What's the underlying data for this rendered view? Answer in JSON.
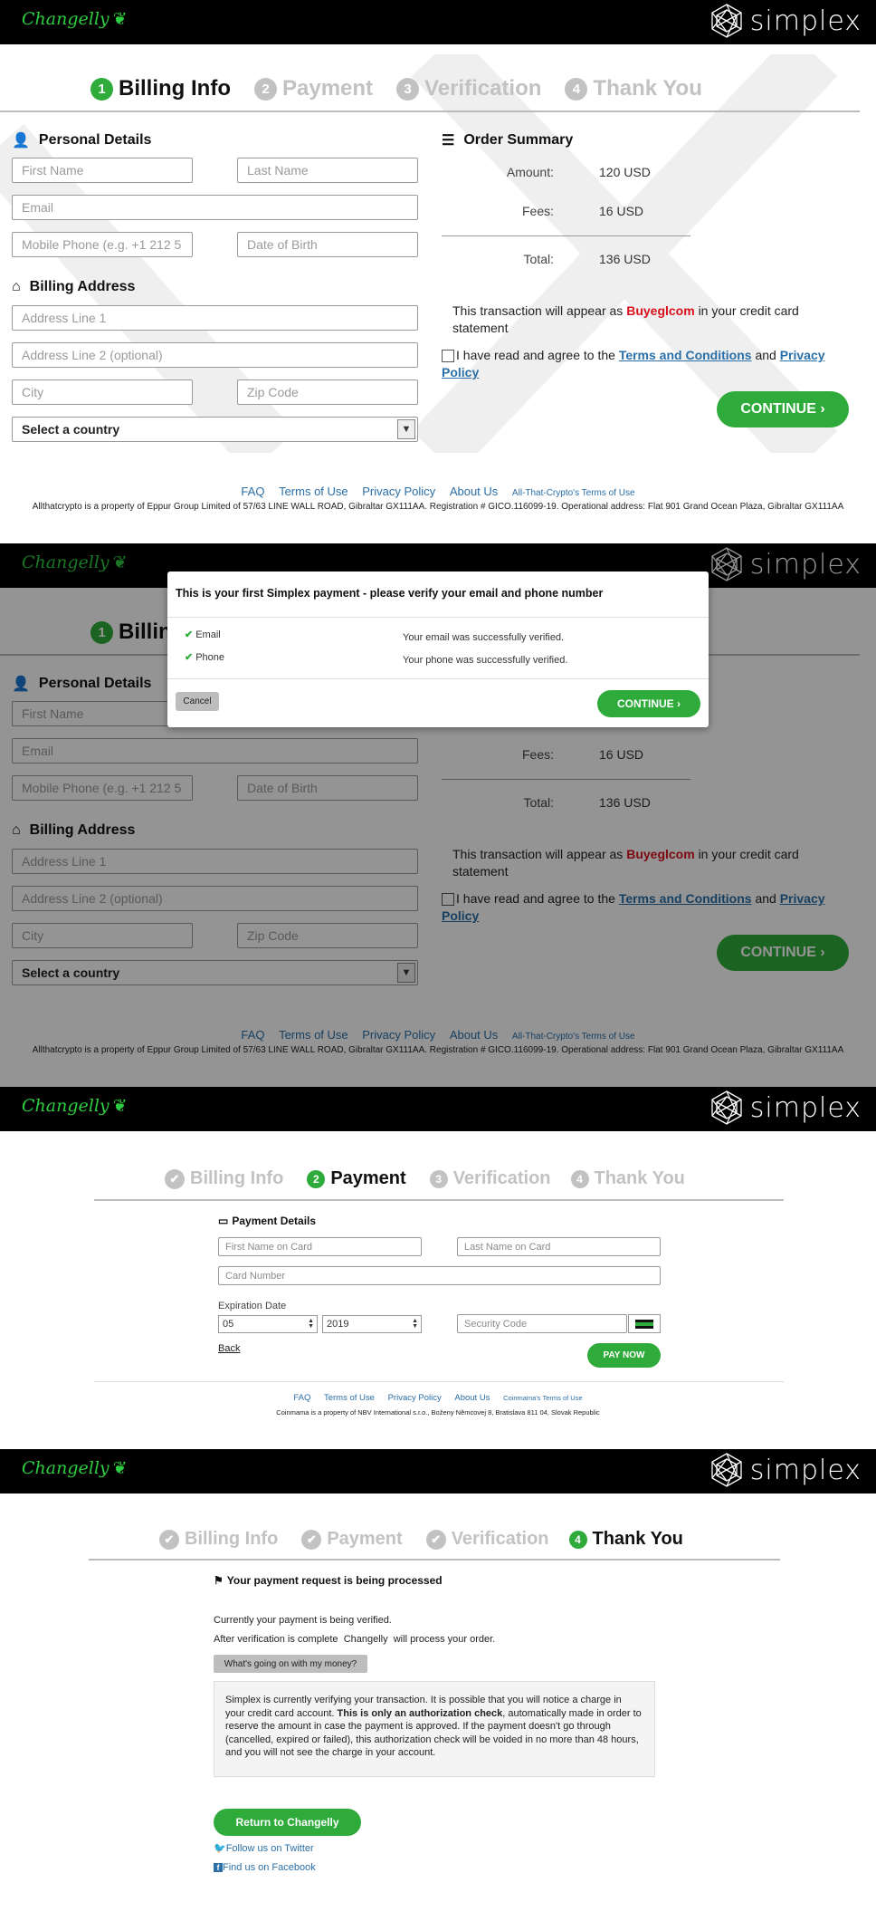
{
  "brand": {
    "left_logo": "Changelly",
    "right_logo": "simplex",
    "accent": "#2eab3a",
    "error_red": "#d9111c",
    "link_blue": "#2a6fa8"
  },
  "steps_billing": [
    {
      "num": "1",
      "label": "Billing Info"
    },
    {
      "num": "2",
      "label": "Payment"
    },
    {
      "num": "3",
      "label": "Verification"
    },
    {
      "num": "4",
      "label": "Thank You"
    }
  ],
  "billing": {
    "personal_title": "Personal Details",
    "first_name_ph": "First Name",
    "last_name_ph": "Last Name",
    "email_ph": "Email",
    "phone_ph": "Mobile Phone (e.g. +1 212 5",
    "dob_ph": "Date of Birth",
    "address_title": "Billing Address",
    "address1_ph": "Address Line 1",
    "address2_ph": "Address Line 2 (optional)",
    "city_ph": "City",
    "zip_ph": "Zip Code",
    "country_value": "Select a country"
  },
  "summary": {
    "title": "Order Summary",
    "amount_label": "Amount:",
    "amount_value": "120 USD",
    "fees_label": "Fees:",
    "fees_value": "16 USD",
    "total_label": "Total:",
    "total_value": "136 USD",
    "note_prefix": "This transaction will appear as",
    "merchant": "Buyeglcom",
    "note_suffix": "in your credit card statement",
    "agree_prefix": "I have read and agree to the",
    "terms_link": "Terms and Conditions",
    "agree_and": "and",
    "privacy_link": "Privacy Policy",
    "continue_label": "CONTINUE"
  },
  "footer1": {
    "links": [
      "FAQ",
      "Terms of Use",
      "Privacy Policy",
      "About Us"
    ],
    "small_link": "All-That-Crypto's Terms of Use",
    "text": "Allthatcrypto is a property of Eppur Group Limited of 57/63 LINE WALL ROAD, Gibraltar GX111AA. Registration # GICO.116099-19. Operational address: Flat 901 Grand Ocean Plaza, Gibraltar GX111AA"
  },
  "modal": {
    "title": "This is your first Simplex payment - please verify your email and phone number",
    "email_label": "Email",
    "email_status": "Your email was successfully verified.",
    "phone_label": "Phone",
    "phone_status": "Your phone was successfully verified.",
    "cancel_label": "Cancel",
    "continue_label": "CONTINUE"
  },
  "payment": {
    "title": "Payment Details",
    "first_name_ph": "First Name on Card",
    "last_name_ph": "Last Name on Card",
    "card_ph": "Card Number",
    "exp_label": "Expiration Date",
    "month": "05",
    "year": "2019",
    "cvv_ph": "Security Code",
    "back_label": "Back",
    "pay_label": "PAY NOW"
  },
  "footer3": {
    "links": [
      "FAQ",
      "Terms of Use",
      "Privacy Policy",
      "About Us"
    ],
    "small_link": "Coinmama's Terms of Use",
    "text": "Coinmama is a property of NBV International s.r.o., Boženy Němcovej 8, Bratislava 811 04, Slovak Republic"
  },
  "thanks": {
    "title": "Your payment request is being processed",
    "line1": "Currently your payment is being verified.",
    "line2_prefix": "After verification is complete",
    "line2_brand": "Changelly",
    "line2_suffix": "will process your order.",
    "question_btn": "What's going on with my money?",
    "box_a": "Simplex is currently verifying your transaction. It is possible that you will notice a charge in your credit card account.",
    "box_bold": "This is only an authorization check",
    "box_b": ", automatically made in order to reserve the amount in case the payment is approved. If the payment doesn't go through (cancelled, expired or failed), this authorization check will be voided in no more than 48 hours, and you will not see the charge in your account.",
    "return_label": "Return to Changelly",
    "twitter": "Follow us on Twitter",
    "facebook": "Find us on Facebook"
  }
}
